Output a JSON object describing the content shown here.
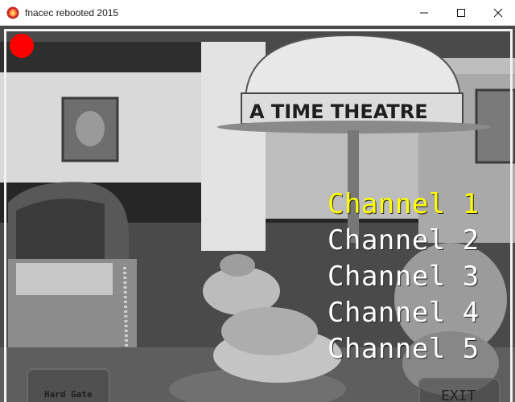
{
  "window": {
    "title": "fnacec rebooted 2015",
    "icon": "app-orb-icon",
    "controls": [
      "minimize-icon",
      "maximize-icon",
      "close-icon"
    ]
  },
  "camera": {
    "recording_indicator_color": "#ff0000",
    "scene_sign_text": "A TIME THEATRE"
  },
  "channels": [
    {
      "label": "Channel 1",
      "active": true
    },
    {
      "label": "Channel 2",
      "active": false
    },
    {
      "label": "Channel 3",
      "active": false
    },
    {
      "label": "Channel 4",
      "active": false
    },
    {
      "label": "Channel 5",
      "active": false
    }
  ],
  "buttons": {
    "left_label": "Hard Gate",
    "exit_label": "EXIT"
  },
  "colors": {
    "active_channel": "#ffff00",
    "inactive_channel": "#ffffff"
  }
}
